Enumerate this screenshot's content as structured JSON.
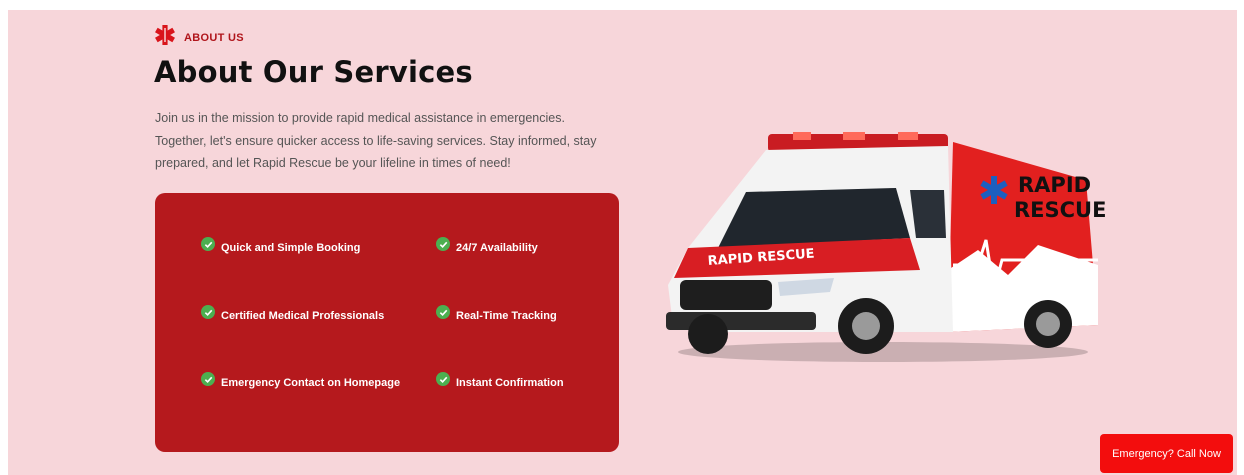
{
  "eyebrow": {
    "label": "ABOUT US",
    "icon": "star-of-life-icon"
  },
  "title": "About Our Services",
  "description": [
    "Join us in the mission to provide rapid medical assistance in emergencies.",
    "Together, let's ensure quicker access to life-saving services. Stay informed, stay",
    "prepared, and let Rapid Rescue be your lifeline in times of need!"
  ],
  "features": [
    "Quick and Simple Booking",
    "24/7 Availability",
    "Certified Medical Professionals",
    "Real-Time Tracking",
    "Emergency Contact on Homepage",
    "Instant Confirmation"
  ],
  "vehicle_image": {
    "logo_line1": "RAPID",
    "logo_line2": "RESCUE",
    "hood_text": "RAPID RESCUE"
  },
  "cta": {
    "label": "Emergency? Call Now"
  },
  "colors": {
    "section_bg": "#f7d6da",
    "accent_red": "#b5191d",
    "cta_red": "#f30d0d",
    "check_green": "#4caf50",
    "title": "#111111",
    "body_text": "#555555"
  }
}
